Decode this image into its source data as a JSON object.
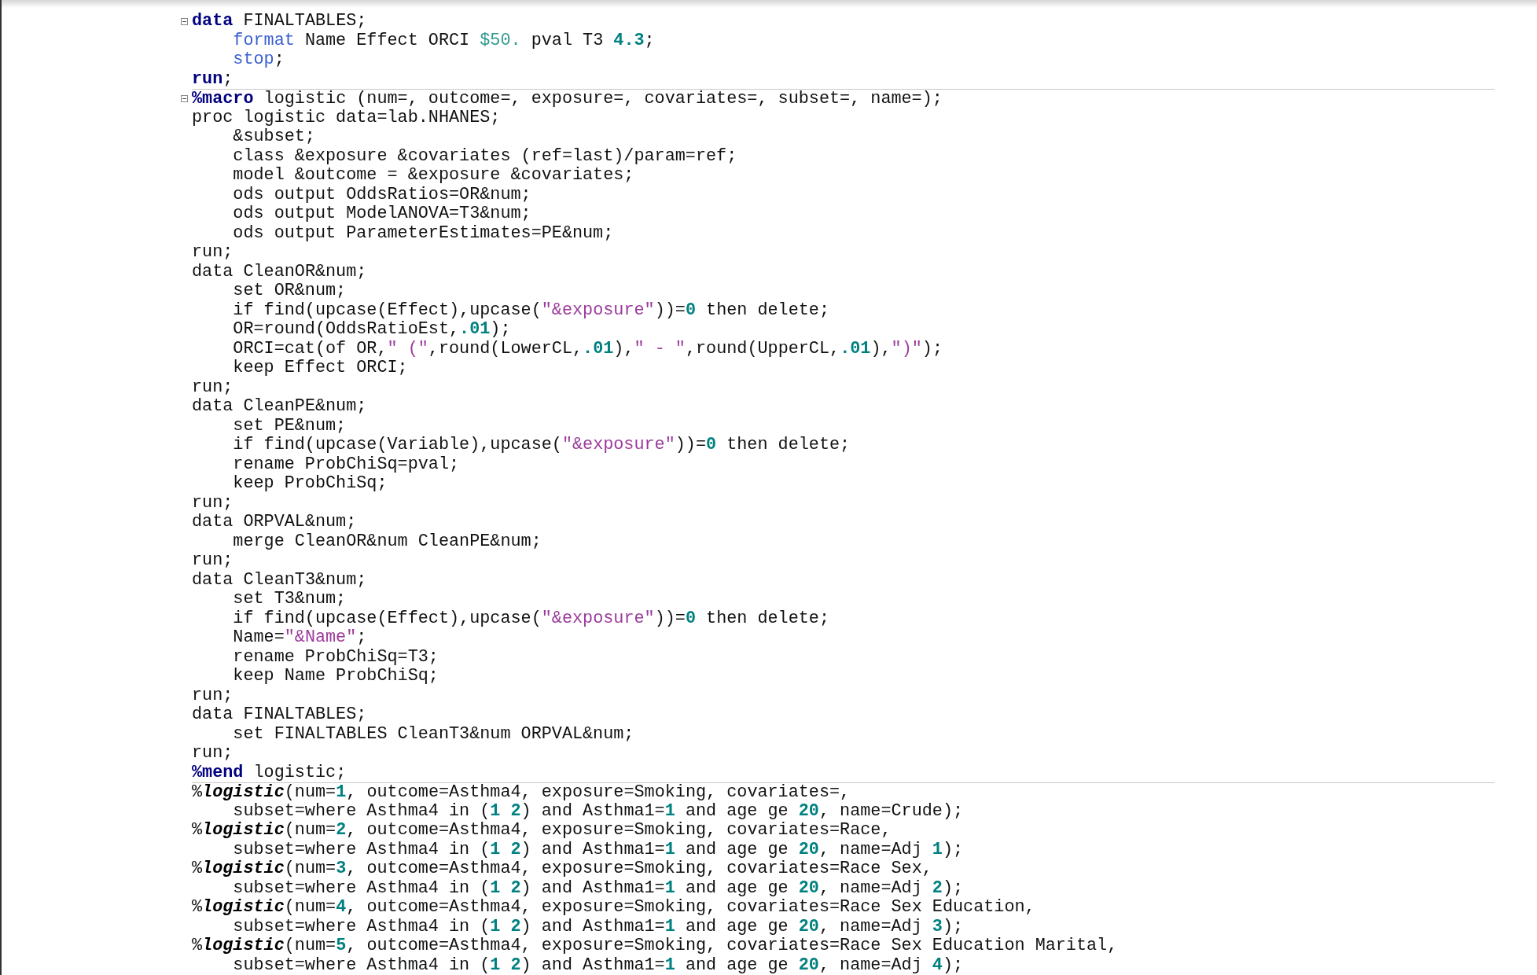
{
  "editor": {
    "lines": [
      {
        "fold": true,
        "divider_above": false,
        "indented": false,
        "tokens": [
          {
            "kind": "keyword",
            "text": "data"
          },
          {
            "kind": "plain",
            "text": " FINALTABLES;"
          }
        ]
      },
      {
        "fold": false,
        "divider_above": false,
        "indented": true,
        "tokens": [
          {
            "kind": "statement",
            "text": "format"
          },
          {
            "kind": "plain",
            "text": " Name Effect ORCI "
          },
          {
            "kind": "format",
            "text": "$50."
          },
          {
            "kind": "plain",
            "text": " pval T3 "
          },
          {
            "kind": "number",
            "text": "4.3"
          },
          {
            "kind": "plain",
            "text": ";"
          }
        ]
      },
      {
        "fold": false,
        "divider_above": false,
        "indented": true,
        "tokens": [
          {
            "kind": "statement",
            "text": "stop"
          },
          {
            "kind": "plain",
            "text": ";"
          }
        ]
      },
      {
        "fold": false,
        "divider_above": false,
        "indented": false,
        "tokens": [
          {
            "kind": "keyword",
            "text": "run"
          },
          {
            "kind": "plain",
            "text": ";"
          }
        ]
      },
      {
        "fold": true,
        "divider_above": true,
        "indented": false,
        "tokens": [
          {
            "kind": "keyword",
            "text": "%macro"
          },
          {
            "kind": "plain",
            "text": " logistic (num=, outcome=, exposure=, covariates=, subset=, name=);"
          }
        ]
      },
      {
        "fold": false,
        "divider_above": false,
        "indented": false,
        "tokens": [
          {
            "kind": "plain",
            "text": "proc logistic data=lab.NHANES;"
          }
        ]
      },
      {
        "fold": false,
        "divider_above": false,
        "indented": true,
        "tokens": [
          {
            "kind": "plain",
            "text": "&subset;"
          }
        ]
      },
      {
        "fold": false,
        "divider_above": false,
        "indented": true,
        "tokens": [
          {
            "kind": "plain",
            "text": "class &exposure &covariates (ref=last)/param=ref;"
          }
        ]
      },
      {
        "fold": false,
        "divider_above": false,
        "indented": true,
        "tokens": [
          {
            "kind": "plain",
            "text": "model &outcome = &exposure &covariates;"
          }
        ]
      },
      {
        "fold": false,
        "divider_above": false,
        "indented": true,
        "tokens": [
          {
            "kind": "plain",
            "text": "ods output OddsRatios=OR&num;"
          }
        ]
      },
      {
        "fold": false,
        "divider_above": false,
        "indented": true,
        "tokens": [
          {
            "kind": "plain",
            "text": "ods output ModelANOVA=T3&num;"
          }
        ]
      },
      {
        "fold": false,
        "divider_above": false,
        "indented": true,
        "tokens": [
          {
            "kind": "plain",
            "text": "ods output ParameterEstimates=PE&num;"
          }
        ]
      },
      {
        "fold": false,
        "divider_above": false,
        "indented": false,
        "tokens": [
          {
            "kind": "plain",
            "text": "run;"
          }
        ]
      },
      {
        "fold": false,
        "divider_above": false,
        "indented": false,
        "tokens": [
          {
            "kind": "plain",
            "text": "data CleanOR&num;"
          }
        ]
      },
      {
        "fold": false,
        "divider_above": false,
        "indented": true,
        "tokens": [
          {
            "kind": "plain",
            "text": "set OR&num;"
          }
        ]
      },
      {
        "fold": false,
        "divider_above": false,
        "indented": true,
        "tokens": [
          {
            "kind": "plain",
            "text": "if find(upcase(Effect),upcase("
          },
          {
            "kind": "string",
            "text": "\"&exposure\""
          },
          {
            "kind": "plain",
            "text": "))="
          },
          {
            "kind": "number",
            "text": "0"
          },
          {
            "kind": "plain",
            "text": " then delete;"
          }
        ]
      },
      {
        "fold": false,
        "divider_above": false,
        "indented": true,
        "tokens": [
          {
            "kind": "plain",
            "text": "OR=round(OddsRatioEst,"
          },
          {
            "kind": "number",
            "text": ".01"
          },
          {
            "kind": "plain",
            "text": ");"
          }
        ]
      },
      {
        "fold": false,
        "divider_above": false,
        "indented": true,
        "tokens": [
          {
            "kind": "plain",
            "text": "ORCI=cat(of OR,"
          },
          {
            "kind": "string",
            "text": "\" (\""
          },
          {
            "kind": "plain",
            "text": ",round(LowerCL,"
          },
          {
            "kind": "number",
            "text": ".01"
          },
          {
            "kind": "plain",
            "text": "),"
          },
          {
            "kind": "string",
            "text": "\" - \""
          },
          {
            "kind": "plain",
            "text": ",round(UpperCL,"
          },
          {
            "kind": "number",
            "text": ".01"
          },
          {
            "kind": "plain",
            "text": "),"
          },
          {
            "kind": "string",
            "text": "\")\""
          },
          {
            "kind": "plain",
            "text": ");"
          }
        ]
      },
      {
        "fold": false,
        "divider_above": false,
        "indented": true,
        "tokens": [
          {
            "kind": "plain",
            "text": "keep Effect ORCI;"
          }
        ]
      },
      {
        "fold": false,
        "divider_above": false,
        "indented": false,
        "tokens": [
          {
            "kind": "plain",
            "text": "run;"
          }
        ]
      },
      {
        "fold": false,
        "divider_above": false,
        "indented": false,
        "tokens": [
          {
            "kind": "plain",
            "text": "data CleanPE&num;"
          }
        ]
      },
      {
        "fold": false,
        "divider_above": false,
        "indented": true,
        "tokens": [
          {
            "kind": "plain",
            "text": "set PE&num;"
          }
        ]
      },
      {
        "fold": false,
        "divider_above": false,
        "indented": true,
        "tokens": [
          {
            "kind": "plain",
            "text": "if find(upcase(Variable),upcase("
          },
          {
            "kind": "string",
            "text": "\"&exposure\""
          },
          {
            "kind": "plain",
            "text": "))="
          },
          {
            "kind": "number",
            "text": "0"
          },
          {
            "kind": "plain",
            "text": " then delete;"
          }
        ]
      },
      {
        "fold": false,
        "divider_above": false,
        "indented": true,
        "tokens": [
          {
            "kind": "plain",
            "text": "rename ProbChiSq=pval;"
          }
        ]
      },
      {
        "fold": false,
        "divider_above": false,
        "indented": true,
        "tokens": [
          {
            "kind": "plain",
            "text": "keep ProbChiSq;"
          }
        ]
      },
      {
        "fold": false,
        "divider_above": false,
        "indented": false,
        "tokens": [
          {
            "kind": "plain",
            "text": "run;"
          }
        ]
      },
      {
        "fold": false,
        "divider_above": false,
        "indented": false,
        "tokens": [
          {
            "kind": "plain",
            "text": "data ORPVAL&num;"
          }
        ]
      },
      {
        "fold": false,
        "divider_above": false,
        "indented": true,
        "tokens": [
          {
            "kind": "plain",
            "text": "merge CleanOR&num CleanPE&num;"
          }
        ]
      },
      {
        "fold": false,
        "divider_above": false,
        "indented": false,
        "tokens": [
          {
            "kind": "plain",
            "text": "run;"
          }
        ]
      },
      {
        "fold": false,
        "divider_above": false,
        "indented": false,
        "tokens": [
          {
            "kind": "plain",
            "text": "data CleanT3&num;"
          }
        ]
      },
      {
        "fold": false,
        "divider_above": false,
        "indented": true,
        "tokens": [
          {
            "kind": "plain",
            "text": "set T3&num;"
          }
        ]
      },
      {
        "fold": false,
        "divider_above": false,
        "indented": true,
        "tokens": [
          {
            "kind": "plain",
            "text": "if find(upcase(Effect),upcase("
          },
          {
            "kind": "string",
            "text": "\"&exposure\""
          },
          {
            "kind": "plain",
            "text": "))="
          },
          {
            "kind": "number",
            "text": "0"
          },
          {
            "kind": "plain",
            "text": " then delete;"
          }
        ]
      },
      {
        "fold": false,
        "divider_above": false,
        "indented": true,
        "tokens": [
          {
            "kind": "plain",
            "text": "Name="
          },
          {
            "kind": "string",
            "text": "\"&Name\""
          },
          {
            "kind": "plain",
            "text": ";"
          }
        ]
      },
      {
        "fold": false,
        "divider_above": false,
        "indented": true,
        "tokens": [
          {
            "kind": "plain",
            "text": "rename ProbChiSq=T3;"
          }
        ]
      },
      {
        "fold": false,
        "divider_above": false,
        "indented": true,
        "tokens": [
          {
            "kind": "plain",
            "text": "keep Name ProbChiSq;"
          }
        ]
      },
      {
        "fold": false,
        "divider_above": false,
        "indented": false,
        "tokens": [
          {
            "kind": "plain",
            "text": "run;"
          }
        ]
      },
      {
        "fold": false,
        "divider_above": false,
        "indented": false,
        "tokens": [
          {
            "kind": "plain",
            "text": "data FINALTABLES;"
          }
        ]
      },
      {
        "fold": false,
        "divider_above": false,
        "indented": true,
        "tokens": [
          {
            "kind": "plain",
            "text": "set FINALTABLES CleanT3&num ORPVAL&num;"
          }
        ]
      },
      {
        "fold": false,
        "divider_above": false,
        "indented": false,
        "tokens": [
          {
            "kind": "plain",
            "text": "run;"
          }
        ]
      },
      {
        "fold": false,
        "divider_above": false,
        "indented": false,
        "tokens": [
          {
            "kind": "keyword",
            "text": "%mend"
          },
          {
            "kind": "plain",
            "text": " logistic;"
          }
        ]
      },
      {
        "fold": false,
        "divider_above": true,
        "indented": false,
        "tokens": [
          {
            "kind": "plain",
            "text": "%"
          },
          {
            "kind": "macro_call",
            "text": "logistic"
          },
          {
            "kind": "plain",
            "text": "(num="
          },
          {
            "kind": "number",
            "text": "1"
          },
          {
            "kind": "plain",
            "text": ", outcome=Asthma4, exposure=Smoking, covariates=,"
          }
        ]
      },
      {
        "fold": false,
        "divider_above": false,
        "indented": true,
        "tokens": [
          {
            "kind": "plain",
            "text": "subset=where Asthma4 in ("
          },
          {
            "kind": "number",
            "text": "1 2"
          },
          {
            "kind": "plain",
            "text": ") and Asthma1="
          },
          {
            "kind": "number",
            "text": "1"
          },
          {
            "kind": "plain",
            "text": " and age ge "
          },
          {
            "kind": "number",
            "text": "20"
          },
          {
            "kind": "plain",
            "text": ", name=Crude);"
          }
        ]
      },
      {
        "fold": false,
        "divider_above": false,
        "indented": false,
        "tokens": [
          {
            "kind": "plain",
            "text": "%"
          },
          {
            "kind": "macro_call",
            "text": "logistic"
          },
          {
            "kind": "plain",
            "text": "(num="
          },
          {
            "kind": "number",
            "text": "2"
          },
          {
            "kind": "plain",
            "text": ", outcome=Asthma4, exposure=Smoking, covariates=Race,"
          }
        ]
      },
      {
        "fold": false,
        "divider_above": false,
        "indented": true,
        "tokens": [
          {
            "kind": "plain",
            "text": "subset=where Asthma4 in ("
          },
          {
            "kind": "number",
            "text": "1 2"
          },
          {
            "kind": "plain",
            "text": ") and Asthma1="
          },
          {
            "kind": "number",
            "text": "1"
          },
          {
            "kind": "plain",
            "text": " and age ge "
          },
          {
            "kind": "number",
            "text": "20"
          },
          {
            "kind": "plain",
            "text": ", name=Adj "
          },
          {
            "kind": "number",
            "text": "1"
          },
          {
            "kind": "plain",
            "text": ");"
          }
        ]
      },
      {
        "fold": false,
        "divider_above": false,
        "indented": false,
        "tokens": [
          {
            "kind": "plain",
            "text": "%"
          },
          {
            "kind": "macro_call",
            "text": "logistic"
          },
          {
            "kind": "plain",
            "text": "(num="
          },
          {
            "kind": "number",
            "text": "3"
          },
          {
            "kind": "plain",
            "text": ", outcome=Asthma4, exposure=Smoking, covariates=Race Sex,"
          }
        ]
      },
      {
        "fold": false,
        "divider_above": false,
        "indented": true,
        "tokens": [
          {
            "kind": "plain",
            "text": "subset=where Asthma4 in ("
          },
          {
            "kind": "number",
            "text": "1 2"
          },
          {
            "kind": "plain",
            "text": ") and Asthma1="
          },
          {
            "kind": "number",
            "text": "1"
          },
          {
            "kind": "plain",
            "text": " and age ge "
          },
          {
            "kind": "number",
            "text": "20"
          },
          {
            "kind": "plain",
            "text": ", name=Adj "
          },
          {
            "kind": "number",
            "text": "2"
          },
          {
            "kind": "plain",
            "text": ");"
          }
        ]
      },
      {
        "fold": false,
        "divider_above": false,
        "indented": false,
        "tokens": [
          {
            "kind": "plain",
            "text": "%"
          },
          {
            "kind": "macro_call",
            "text": "logistic"
          },
          {
            "kind": "plain",
            "text": "(num="
          },
          {
            "kind": "number",
            "text": "4"
          },
          {
            "kind": "plain",
            "text": ", outcome=Asthma4, exposure=Smoking, covariates=Race Sex Education,"
          }
        ]
      },
      {
        "fold": false,
        "divider_above": false,
        "indented": true,
        "tokens": [
          {
            "kind": "plain",
            "text": "subset=where Asthma4 in ("
          },
          {
            "kind": "number",
            "text": "1 2"
          },
          {
            "kind": "plain",
            "text": ") and Asthma1="
          },
          {
            "kind": "number",
            "text": "1"
          },
          {
            "kind": "plain",
            "text": " and age ge "
          },
          {
            "kind": "number",
            "text": "20"
          },
          {
            "kind": "plain",
            "text": ", name=Adj "
          },
          {
            "kind": "number",
            "text": "3"
          },
          {
            "kind": "plain",
            "text": ");"
          }
        ]
      },
      {
        "fold": false,
        "divider_above": false,
        "indented": false,
        "tokens": [
          {
            "kind": "plain",
            "text": "%"
          },
          {
            "kind": "macro_call",
            "text": "logistic"
          },
          {
            "kind": "plain",
            "text": "(num="
          },
          {
            "kind": "number",
            "text": "5"
          },
          {
            "kind": "plain",
            "text": ", outcome=Asthma4, exposure=Smoking, covariates=Race Sex Education Marital,"
          }
        ]
      },
      {
        "fold": false,
        "divider_above": false,
        "indented": true,
        "tokens": [
          {
            "kind": "plain",
            "text": "subset=where Asthma4 in ("
          },
          {
            "kind": "number",
            "text": "1 2"
          },
          {
            "kind": "plain",
            "text": ") and Asthma1="
          },
          {
            "kind": "number",
            "text": "1"
          },
          {
            "kind": "plain",
            "text": " and age ge "
          },
          {
            "kind": "number",
            "text": "20"
          },
          {
            "kind": "plain",
            "text": ", name=Adj "
          },
          {
            "kind": "number",
            "text": "4"
          },
          {
            "kind": "plain",
            "text": ");"
          }
        ]
      }
    ]
  }
}
